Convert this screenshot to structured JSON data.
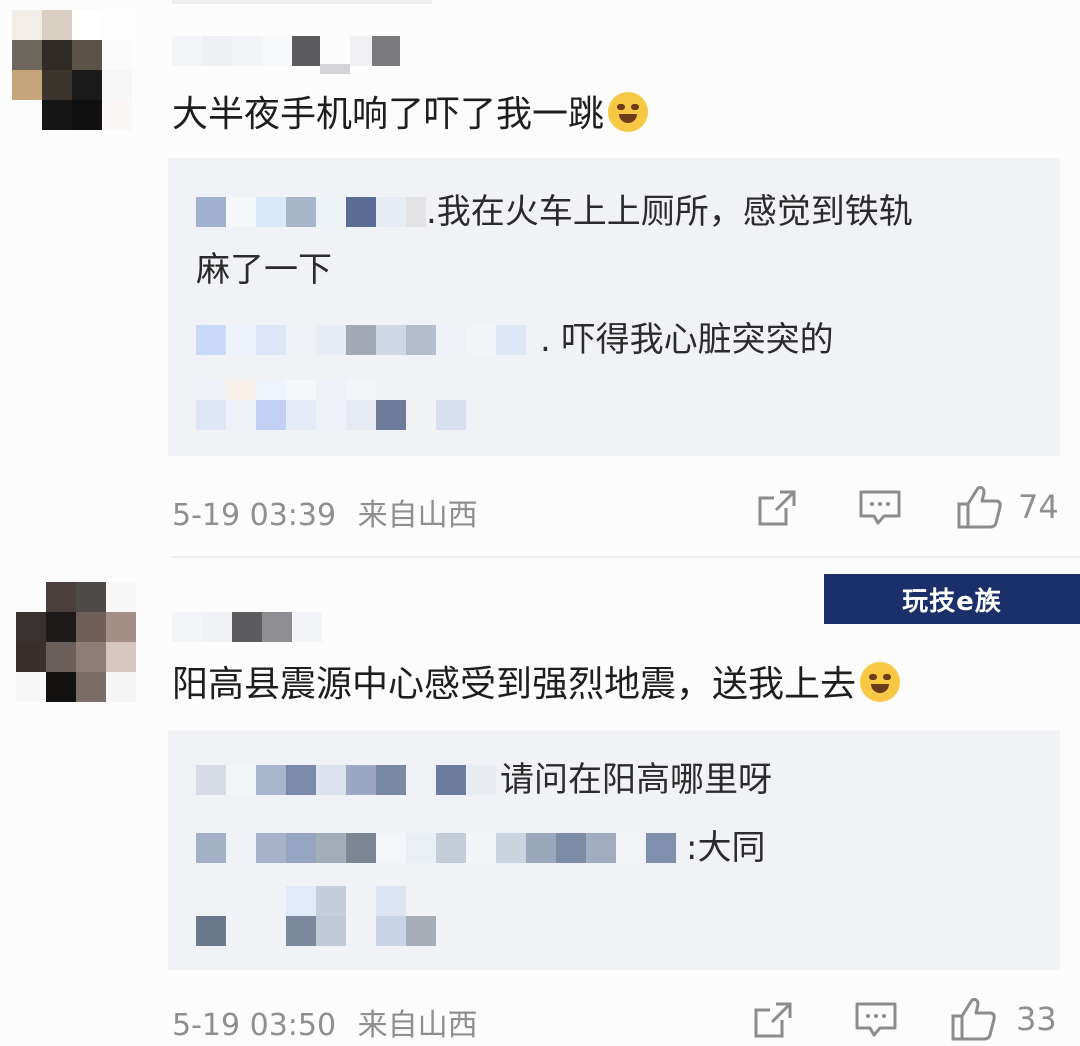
{
  "comments": [
    {
      "text": "大半夜手机响了吓了我一跳",
      "emoji": "laughing-tears-emoji",
      "replies": [
        {
          "text": ".我在火车上上厕所，感觉到铁轨"
        },
        {
          "text": "麻了一下"
        },
        {
          "text": ". 吓得我心脏突突的"
        }
      ],
      "time": "5-19 03:39",
      "location": "来自山西",
      "likes": "74"
    },
    {
      "text": "阳高县震源中心感受到强烈地震，送我上去",
      "emoji": "crying-emoji",
      "replies": [
        {
          "text": "请问在阳高哪里呀"
        },
        {
          "text": ":大同"
        }
      ],
      "time": "5-19 03:50",
      "location": "来自山西",
      "likes": "33"
    }
  ],
  "watermark": "玩技e族",
  "colors": {
    "reply_bg": "#f1f2f5",
    "meta_text": "#8f8f8f",
    "watermark_bg": "#1b2f6b"
  }
}
